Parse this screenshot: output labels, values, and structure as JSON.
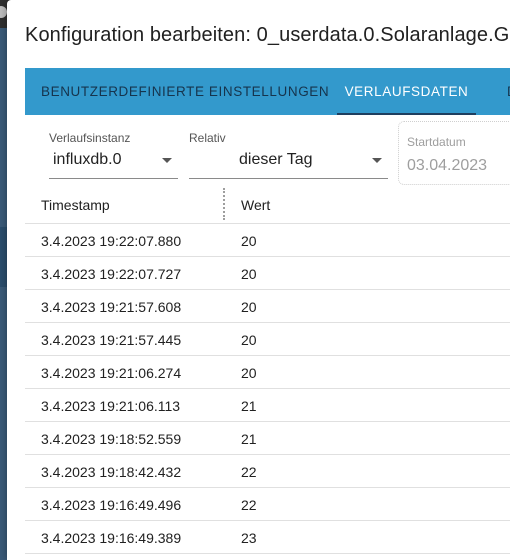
{
  "dialog": {
    "title": "Konfiguration bearbeiten: 0_userdata.0.Solaranlage.G"
  },
  "tabs": [
    {
      "label": "BENUTZERDEFINIERTE EINSTELLUNGEN",
      "active": false
    },
    {
      "label": "VERLAUFSDATEN",
      "active": true
    },
    {
      "label": "D",
      "active": false
    }
  ],
  "filters": {
    "instance": {
      "label": "Verlaufsinstanz",
      "value": "influxdb.0"
    },
    "relative": {
      "label": "Relativ",
      "value": "dieser Tag"
    },
    "start_date": {
      "label": "Startdatum",
      "value": "03.04.2023"
    }
  },
  "table": {
    "columns": [
      "Timestamp",
      "Wert"
    ],
    "rows": [
      {
        "ts": "3.4.2023 19:22:07.880",
        "val": "20"
      },
      {
        "ts": "3.4.2023 19:22:07.727",
        "val": "20"
      },
      {
        "ts": "3.4.2023 19:21:57.608",
        "val": "20"
      },
      {
        "ts": "3.4.2023 19:21:57.445",
        "val": "20"
      },
      {
        "ts": "3.4.2023 19:21:06.274",
        "val": "20"
      },
      {
        "ts": "3.4.2023 19:21:06.113",
        "val": "21"
      },
      {
        "ts": "3.4.2023 19:18:52.559",
        "val": "21"
      },
      {
        "ts": "3.4.2023 19:18:42.432",
        "val": "22"
      },
      {
        "ts": "3.4.2023 19:16:49.496",
        "val": "22"
      },
      {
        "ts": "3.4.2023 19:16:49.389",
        "val": "23"
      }
    ]
  },
  "colors": {
    "tab_bar": "#3399cc",
    "tab_active_text": "#ffffff",
    "tab_inactive_text": "#16344d",
    "backdrop": "#3a5a78"
  }
}
